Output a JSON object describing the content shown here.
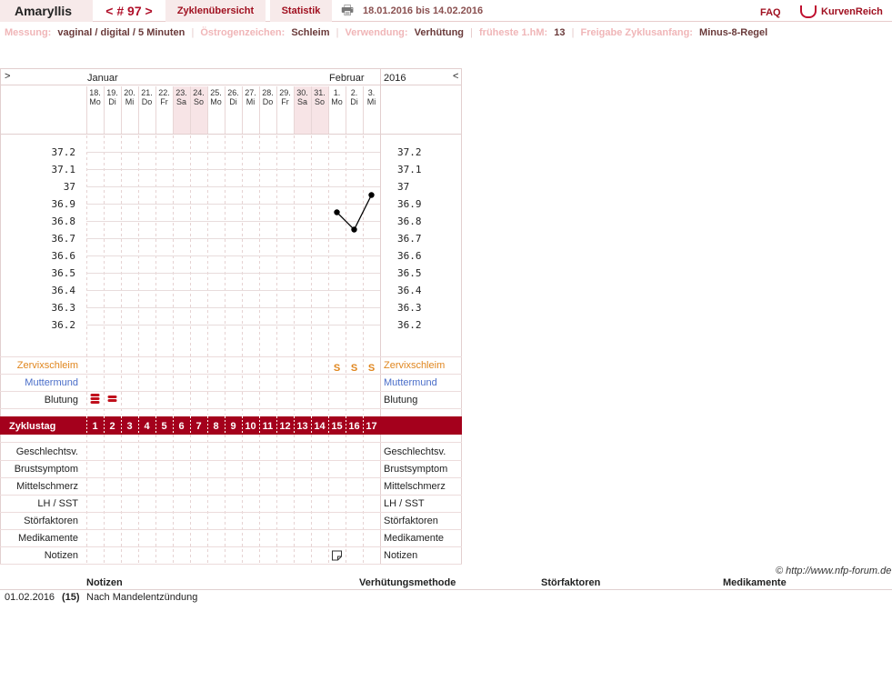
{
  "top": {
    "user": "Amaryllis",
    "cycle_nav": "< # 97 >",
    "tab_overview": "Zyklenübersicht",
    "tab_stats": "Statistik",
    "date_range": "18.01.2016 bis 14.02.2016",
    "faq": "FAQ",
    "brand": "KurvenReich"
  },
  "info": [
    {
      "label": "Messung:",
      "value": "vaginal / digital / 5 Minuten"
    },
    {
      "label": "Östrogenzeichen:",
      "value": "Schleim"
    },
    {
      "label": "Verwendung:",
      "value": "Verhütung"
    },
    {
      "label": "früheste 1.hM:",
      "value": "13"
    },
    {
      "label": "Freigabe Zyklusanfang:",
      "value": "Minus-8-Regel"
    }
  ],
  "chart_nav": {
    "left": ">",
    "right": "<"
  },
  "months": [
    {
      "name": "Januar",
      "start": 0
    },
    {
      "name": "Februar",
      "start": 14
    }
  ],
  "year": "2016",
  "days": [
    {
      "d": "18.",
      "w": "Mo",
      "weekend": false
    },
    {
      "d": "19.",
      "w": "Di",
      "weekend": false
    },
    {
      "d": "20.",
      "w": "Mi",
      "weekend": false
    },
    {
      "d": "21.",
      "w": "Do",
      "weekend": false
    },
    {
      "d": "22.",
      "w": "Fr",
      "weekend": false
    },
    {
      "d": "23.",
      "w": "Sa",
      "weekend": true
    },
    {
      "d": "24.",
      "w": "So",
      "weekend": true
    },
    {
      "d": "25.",
      "w": "Mo",
      "weekend": false
    },
    {
      "d": "26.",
      "w": "Di",
      "weekend": false
    },
    {
      "d": "27.",
      "w": "Mi",
      "weekend": false
    },
    {
      "d": "28.",
      "w": "Do",
      "weekend": false
    },
    {
      "d": "29.",
      "w": "Fr",
      "weekend": false
    },
    {
      "d": "30.",
      "w": "Sa",
      "weekend": true
    },
    {
      "d": "31.",
      "w": "So",
      "weekend": true
    },
    {
      "d": "1.",
      "w": "Mo",
      "weekend": false
    },
    {
      "d": "2.",
      "w": "Di",
      "weekend": false
    },
    {
      "d": "3.",
      "w": "Mi",
      "weekend": false
    }
  ],
  "temp_ticks": [
    "37.2",
    "37.1",
    "37",
    "36.9",
    "36.8",
    "36.7",
    "36.6",
    "36.5",
    "36.4",
    "36.3",
    "36.2"
  ],
  "chart_data": {
    "type": "line",
    "x": [
      15,
      16,
      17
    ],
    "y": [
      36.85,
      36.75,
      36.95
    ],
    "xlabel": "Zyklustag",
    "ylim": [
      36.2,
      37.2
    ]
  },
  "rows_top": [
    {
      "label": "Zervixschleim",
      "color": "#e0861e"
    },
    {
      "label": "Muttermund",
      "color": "#4a6ec9"
    },
    {
      "label": "Blutung",
      "color": "#222222"
    }
  ],
  "mucus_marks": [
    {
      "day": 15,
      "text": "S"
    },
    {
      "day": 16,
      "text": "S"
    },
    {
      "day": 17,
      "text": "S"
    }
  ],
  "bleeding": [
    {
      "day": 1,
      "level": "heavy"
    },
    {
      "day": 2,
      "level": "medium"
    }
  ],
  "cycle_label": "Zyklustag",
  "cycle_days": [
    "1",
    "2",
    "3",
    "4",
    "5",
    "6",
    "7",
    "8",
    "9",
    "10",
    "11",
    "12",
    "13",
    "14",
    "15",
    "16",
    "17"
  ],
  "rows_bottom": [
    "Geschlechtsv.",
    "Brustsymptom",
    "Mittelschmerz",
    "LH / SST",
    "Störfaktoren",
    "Medikamente",
    "Notizen"
  ],
  "note_marker_day": 15,
  "copyright": "© http://www.nfp-forum.de",
  "notes_table": {
    "headers": [
      "Notizen",
      "Verhütungsmethode",
      "Störfaktoren",
      "Medikamente"
    ],
    "rows": [
      {
        "date": "01.02.2016",
        "day": "(15)",
        "text": "Nach Mandelentzündung"
      }
    ]
  },
  "colors": {
    "accent": "#a01020",
    "weekend": "#f7e4e6",
    "bar": "#a4001c"
  }
}
